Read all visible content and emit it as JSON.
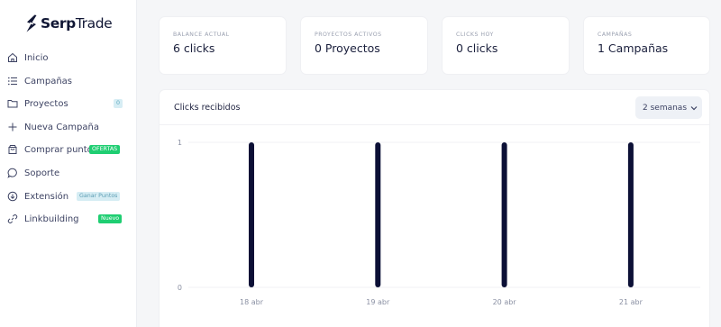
{
  "brand": {
    "logo_bold": "Serp",
    "logo_light": "Trade"
  },
  "sidebar": {
    "items": [
      {
        "label": "Inicio",
        "icon": "home-icon"
      },
      {
        "label": "Campañas",
        "icon": "list-icon"
      },
      {
        "label": "Proyectos",
        "icon": "folder-icon",
        "badge": "0"
      },
      {
        "label": "Nueva Campaña",
        "icon": "plus-icon"
      },
      {
        "label": "Comprar puntos",
        "icon": "bag-icon",
        "badge": "OFERTAS"
      },
      {
        "label": "Soporte",
        "icon": "chat-icon"
      },
      {
        "label": "Extensión",
        "icon": "download-icon",
        "badge": "Ganar Puntos"
      },
      {
        "label": "Linkbuilding",
        "icon": "link-icon",
        "badge": "Nuevo"
      }
    ]
  },
  "stats": [
    {
      "label": "BALANCE ACTUAL",
      "value": "6 clicks"
    },
    {
      "label": "PROYECTOS ACTIVOS",
      "value": "0 Proyectos"
    },
    {
      "label": "CLICKS HOY",
      "value": "0 clicks"
    },
    {
      "label": "CAMPAÑAS",
      "value": "1 Campañas"
    }
  ],
  "panel": {
    "title": "Clicks recibidos",
    "period": "2 semanas"
  },
  "colors": {
    "bar": "#0c1036",
    "badge_green": "#1fce72",
    "badge_blue": "#d6edf4"
  },
  "chart_data": {
    "type": "bar",
    "categories": [
      "18 abr",
      "19 abr",
      "20 abr",
      "21 abr"
    ],
    "values": [
      1,
      1,
      1,
      1
    ],
    "ylim": [
      0,
      1
    ],
    "yticks": [
      "0",
      "1"
    ],
    "grid": true
  }
}
